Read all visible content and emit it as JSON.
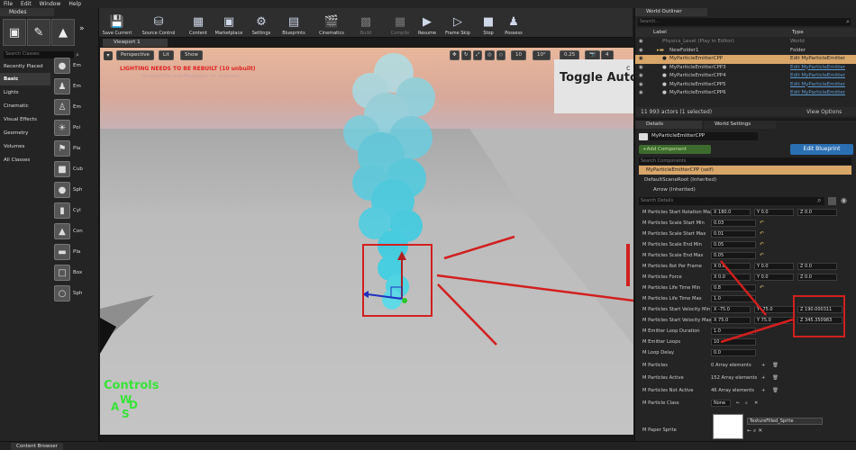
{
  "menu": [
    "File",
    "Edit",
    "Window",
    "Help"
  ],
  "modes": {
    "tab_title": "Modes",
    "search_placeholder": "Search Classes",
    "categories": [
      "Recently Placed",
      "Basic",
      "Lights",
      "Cinematic",
      "Visual Effects",
      "Geometry",
      "Volumes",
      "All Classes"
    ],
    "shapes": [
      "Em",
      "Em",
      "Em",
      "Poi",
      "Pla",
      "Cub",
      "Sph",
      "Cyl",
      "Con",
      "Pla",
      "Box",
      "Sph"
    ]
  },
  "toolbar": {
    "save_current": "Save Current",
    "source_control": "Source Control",
    "content": "Content",
    "marketplace": "Marketplace",
    "settings": "Settings",
    "blueprints": "Blueprints",
    "cinematics": "Cinematics",
    "build": "Build",
    "compile": "Compile",
    "resume": "Resume",
    "frame_skip": "Frame Skip",
    "stop": "Stop",
    "possess": "Possess"
  },
  "viewport": {
    "tab_title": "Viewport 1",
    "perspective": "Perspective",
    "lit": "Lit",
    "show": "Show",
    "warning": "LIGHTING NEEDS TO BE REBUILT (10 unbuilt)",
    "warning_sub": "'DisableAllScreenMessages' to suppress",
    "grid_snap": "10",
    "rot_snap": "10°",
    "scale_snap": "0.25",
    "cam_speed": "4",
    "toggle_text": "Toggle AutoRe",
    "controls_label": "Controls",
    "wasd": {
      "w": "W",
      "a": "A",
      "d": "D",
      "s": "S"
    }
  },
  "outliner": {
    "tab_title": "World Outliner",
    "search_placeholder": "Search...",
    "col_label": "Label",
    "col_type": "Type",
    "rows": [
      {
        "label": "Physics_Level (Play in Editor)",
        "type": "World"
      },
      {
        "label": "NewFolder1",
        "type": "Folder"
      },
      {
        "label": "MyParticleEmitterCPP",
        "type": "Edit MyParticleEmitter"
      },
      {
        "label": "MyParticleEmitterCPP3",
        "type": "Edit MyParticleEmitter"
      },
      {
        "label": "MyParticleEmitterCPP4",
        "type": "Edit MyParticleEmitter"
      },
      {
        "label": "MyParticleEmitterCPP5",
        "type": "Edit MyParticleEmitter"
      },
      {
        "label": "MyParticleEmitterCPP6",
        "type": "Edit MyParticleEmitter"
      }
    ],
    "actor_count": "11 993 actors (1 selected)",
    "view_options": "View Options"
  },
  "details": {
    "tab_title": "Details",
    "tab2_title": "World Settings",
    "name_value": "MyParticleEmitterCPP",
    "add_component": "+Add Component",
    "edit_blueprint": "Edit Blueprint",
    "search_components": "Search Components",
    "self_item": "MyParticleEmitterCPP (self)",
    "scene_root": "DefaultSceneRoot (Inherited)",
    "arrow_item": "Arrow (Inherited)",
    "search_details": "Search Details",
    "props": [
      {
        "name": "M Particles Start Rotation Max",
        "x": "X 180.0",
        "y": "Y 0.0",
        "z": "Z 0.0"
      },
      {
        "name": "M Particles Scale Start Min",
        "v": "0.03"
      },
      {
        "name": "M Particles Scale Start Max",
        "v": "0.01"
      },
      {
        "name": "M Particles Scale End Min",
        "v": "0.05"
      },
      {
        "name": "M Particles Scale End Max",
        "v": "0.05"
      },
      {
        "name": "M Particles Rot Per Frame",
        "x": "X 0.0",
        "y": "Y 0.0",
        "z": "Z 0.0"
      },
      {
        "name": "M Particles Force",
        "x": "X 0.0",
        "y": "Y 0.0",
        "z": "Z 0.0"
      },
      {
        "name": "M Particles Life Time Min",
        "v": "0.8"
      },
      {
        "name": "M Particles Life Time Max",
        "v": "1.0"
      },
      {
        "name": "M Particles Start Velocity Min",
        "x": "X -75.0",
        "y": "Y -75.0",
        "z": "Z 190.000311"
      },
      {
        "name": "M Particles Start Velocity Max",
        "x": "X 75.0",
        "y": "Y 75.0",
        "z": "Z 345.350983"
      },
      {
        "name": "M Emitter Loop Duration",
        "v": "1.0"
      },
      {
        "name": "M Emitter Loops",
        "v": "10"
      },
      {
        "name": "M Loop Delay",
        "v": "0.0"
      },
      {
        "name": "M Particles",
        "arr": "0 Array elements"
      },
      {
        "name": "M Particles Active",
        "arr": "152 Array elements"
      },
      {
        "name": "M Particles Not Active",
        "arr": "46 Array elements"
      }
    ],
    "particle_class_label": "M Particle Class",
    "particle_class_value": "None",
    "paper_sprite_label": "M Paper Sprite",
    "paper_sprite_value": "TextureFilled_Sprite"
  },
  "content_browser": "Content Browser"
}
